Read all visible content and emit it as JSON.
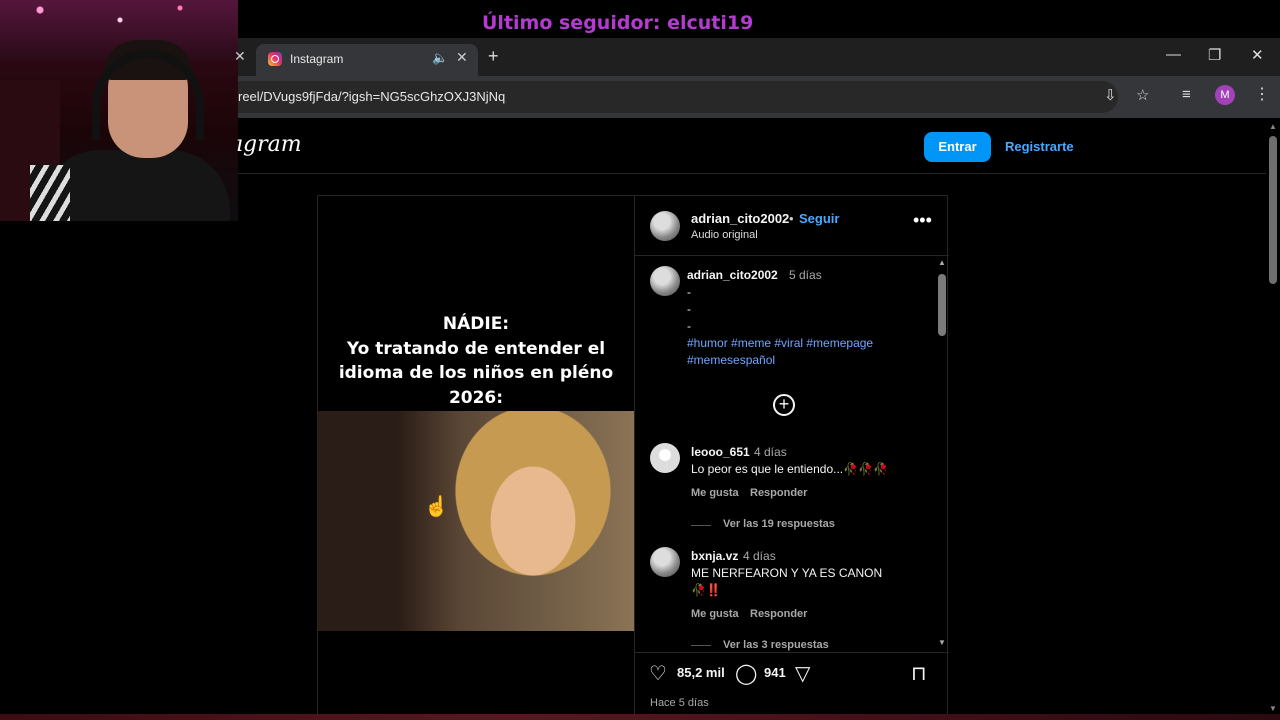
{
  "overlay": {
    "last_follower": "Último seguidor: elcuti19"
  },
  "browser": {
    "tab_title": "Instagram",
    "new_tab_glyph": "+",
    "url": "reel/DVugs9fjFda/?igsh=NG5scGhzOXJ3NjNq",
    "profile_initial": "M"
  },
  "instagram": {
    "logo_text": "ıgram",
    "login_label": "Entrar",
    "register_label": "Registrarte",
    "post": {
      "meme_text": "NÁDIE:\nYo tratando de entender el idioma de los niños en pléno 2026:",
      "author": "adrian_cito2002",
      "separator": "•",
      "follow_label": "Seguir",
      "audio": "Audio original",
      "caption": {
        "user": "adrian_cito2002",
        "time": "5 días",
        "lines": [
          "-",
          "-",
          "-"
        ],
        "hashtags_line1": "#humor #meme #viral #memepage",
        "hashtags_line2": "#memesespañol"
      },
      "comments": [
        {
          "user": "leooo_651",
          "time": "4 días",
          "text": "Lo peor es que le entiendo...🥀🥀🥀",
          "text2": "",
          "like": "Me gusta",
          "reply": "Responder",
          "view_replies": "Ver las 19 respuestas"
        },
        {
          "user": "bxnja.vz",
          "time": "4 días",
          "text": "ME NERFEARON Y YA ES CANON",
          "text2": "🥀‼️",
          "like": "Me gusta",
          "reply": "Responder",
          "view_replies": "Ver las 3 respuestas"
        }
      ],
      "likes": "85,2 mil",
      "comments_count": "941",
      "posted": "Hace 5 días"
    }
  },
  "colors": {
    "accent_blue": "#0095f6",
    "link_blue": "#4aa8ff",
    "overlay_purple": "#b33bd0"
  },
  "icons": [
    "instagram-favicon",
    "speaker-icon",
    "close-icon",
    "plus-icon",
    "install-icon",
    "star-icon",
    "media-icon",
    "more-icon",
    "heart-icon",
    "comment-icon",
    "share-icon",
    "bookmark-icon",
    "cursor-icon"
  ]
}
